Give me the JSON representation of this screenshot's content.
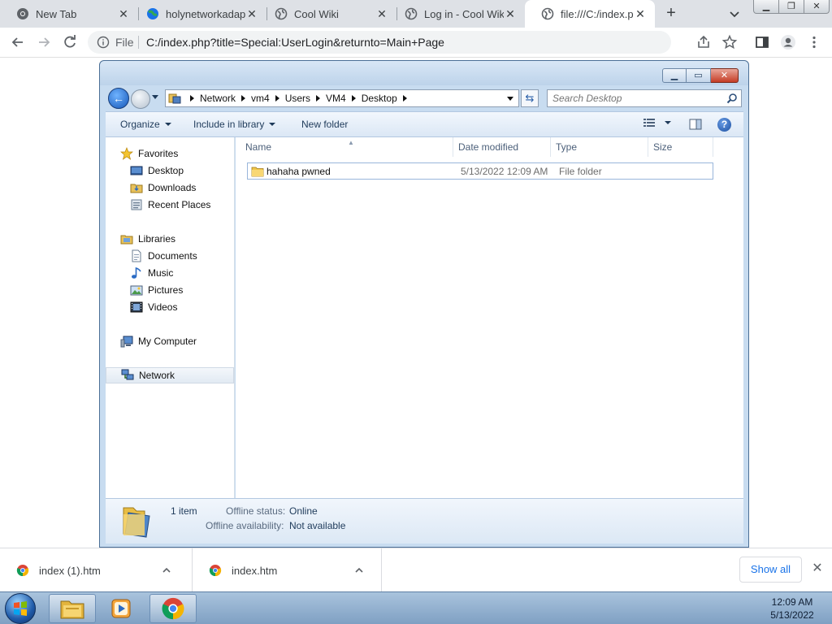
{
  "browser": {
    "tabs": [
      {
        "title": "New Tab",
        "favicon": "chrome-icon"
      },
      {
        "title": "holynetworkadap",
        "favicon": "globe-icon"
      },
      {
        "title": "Cool Wiki",
        "favicon": "globe-icon"
      },
      {
        "title": "Log in - Cool Wiki",
        "favicon": "globe-icon"
      },
      {
        "title": "file:///C:/index.ph",
        "favicon": "globe-icon",
        "active": true
      }
    ],
    "new_tab": "+",
    "address": {
      "scheme_label": "File",
      "url": "C:/index.php?title=Special:UserLogin&returnto=Main+Page"
    }
  },
  "explorer": {
    "breadcrumbs": [
      "Network",
      "vm4",
      "Users",
      "VM4",
      "Desktop"
    ],
    "search_placeholder": "Search Desktop",
    "commands": {
      "organize": "Organize",
      "include_in_library": "Include in library",
      "new_folder": "New folder"
    },
    "nav": {
      "favorites": {
        "label": "Favorites",
        "items": [
          "Desktop",
          "Downloads",
          "Recent Places"
        ]
      },
      "libraries": {
        "label": "Libraries",
        "items": [
          "Documents",
          "Music",
          "Pictures",
          "Videos"
        ]
      },
      "computer": {
        "label": "My Computer"
      },
      "network": {
        "label": "Network",
        "selected": true
      }
    },
    "columns": [
      "Name",
      "Date modified",
      "Type",
      "Size"
    ],
    "files": [
      {
        "name": "hahaha pwned",
        "date_modified": "5/13/2022 12:09 AM",
        "type": "File folder",
        "size": ""
      }
    ],
    "details": {
      "count": "1 item",
      "offline_status_label": "Offline status:",
      "offline_status_value": "Online",
      "offline_availability_label": "Offline availability:",
      "offline_availability_value": "Not available"
    }
  },
  "downloads": {
    "items": [
      "index (1).htm",
      "index.htm"
    ],
    "show_all": "Show all"
  },
  "taskbar": {
    "time": "12:09 AM",
    "date": "5/13/2022"
  },
  "colors": {
    "link_blue": "#1a73e8",
    "explorer_frame": "#c8dcf0",
    "taskbar": "#7fa0c3"
  }
}
